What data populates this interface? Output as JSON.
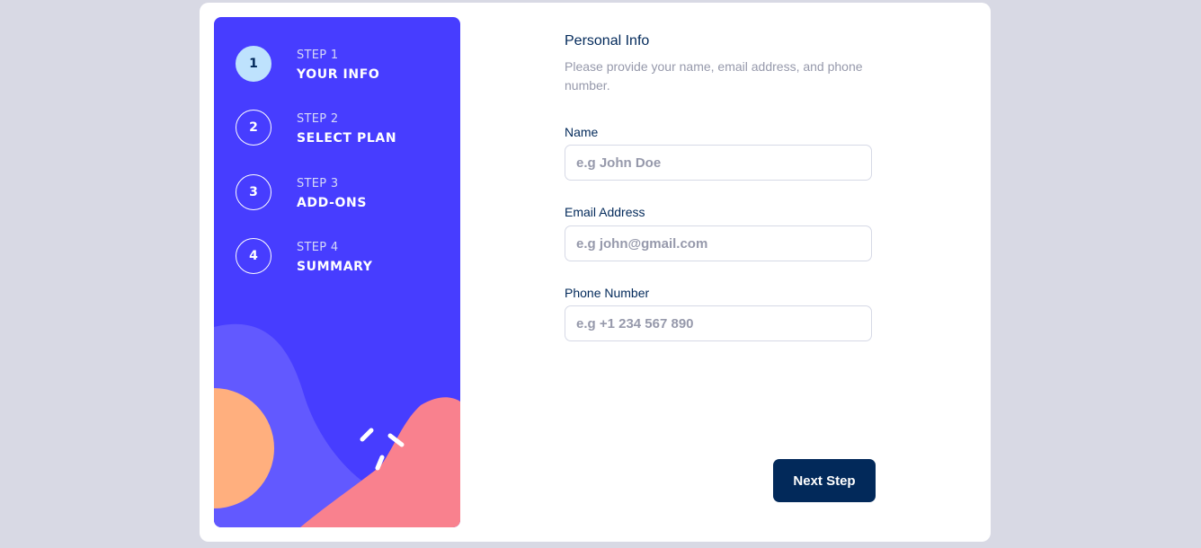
{
  "sidebar": {
    "steps": [
      {
        "number": "1",
        "kicker": "STEP 1",
        "title": "YOUR INFO",
        "active": true
      },
      {
        "number": "2",
        "kicker": "STEP 2",
        "title": "SELECT PLAN",
        "active": false
      },
      {
        "number": "3",
        "kicker": "STEP 3",
        "title": "ADD-ONS",
        "active": false
      },
      {
        "number": "4",
        "kicker": "STEP 4",
        "title": "SUMMARY",
        "active": false
      }
    ]
  },
  "form": {
    "title": "Personal Info",
    "subtitle": "Please provide your name, email address, and phone number.",
    "fields": [
      {
        "label": "Name",
        "placeholder": "e.g John Doe",
        "value": ""
      },
      {
        "label": "Email Address",
        "placeholder": "e.g john@gmail.com",
        "value": ""
      },
      {
        "label": "Phone Number",
        "placeholder": "e.g +1 234 567 890",
        "value": ""
      }
    ],
    "next_label": "Next Step"
  },
  "colors": {
    "page_bg": "#d8d9e4",
    "sidebar_bg": "#473dff",
    "active_step": "#bee2fd",
    "primary_text": "#02295a",
    "muted_text": "#9699ab",
    "orange_blob": "#ffaf7e",
    "pink_blob": "#f9818e",
    "purple_blob": "#6259ff"
  }
}
